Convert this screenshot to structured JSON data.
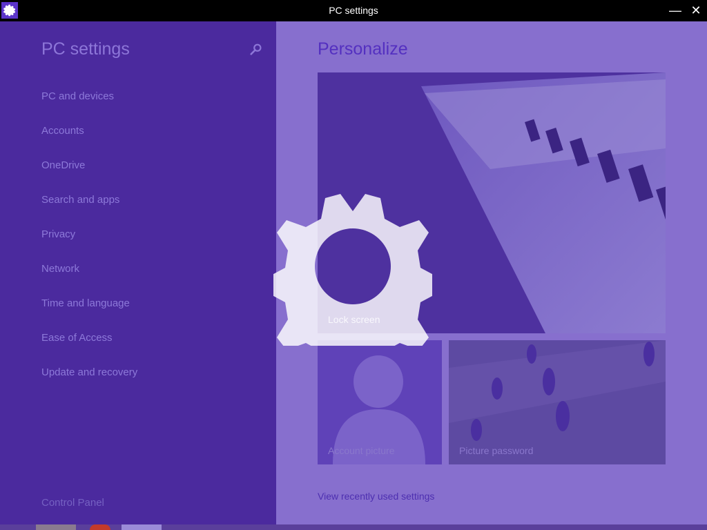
{
  "window": {
    "title": "PC settings",
    "minimize_glyph": "—",
    "close_glyph": "✕"
  },
  "nav": {
    "title": "PC settings",
    "items": [
      {
        "label": "PC and devices"
      },
      {
        "label": "Accounts"
      },
      {
        "label": "OneDrive"
      },
      {
        "label": "Search and apps"
      },
      {
        "label": "Privacy"
      },
      {
        "label": "Network"
      },
      {
        "label": "Time and language"
      },
      {
        "label": "Ease of Access"
      },
      {
        "label": "Update and recovery"
      }
    ],
    "control_panel": "Control Panel"
  },
  "content": {
    "heading": "Personalize",
    "tiles": {
      "lock_screen": "Lock screen",
      "account_picture": "Account picture",
      "picture_password": "Picture password"
    },
    "recent_link": "View recently used settings"
  },
  "icons": {
    "app_icon": "gear-icon",
    "search": "search-icon",
    "splash": "gear-icon"
  },
  "colors": {
    "nav_bg": "#4b2a9e",
    "content_bg": "#876fce",
    "accent": "#5430c0"
  }
}
